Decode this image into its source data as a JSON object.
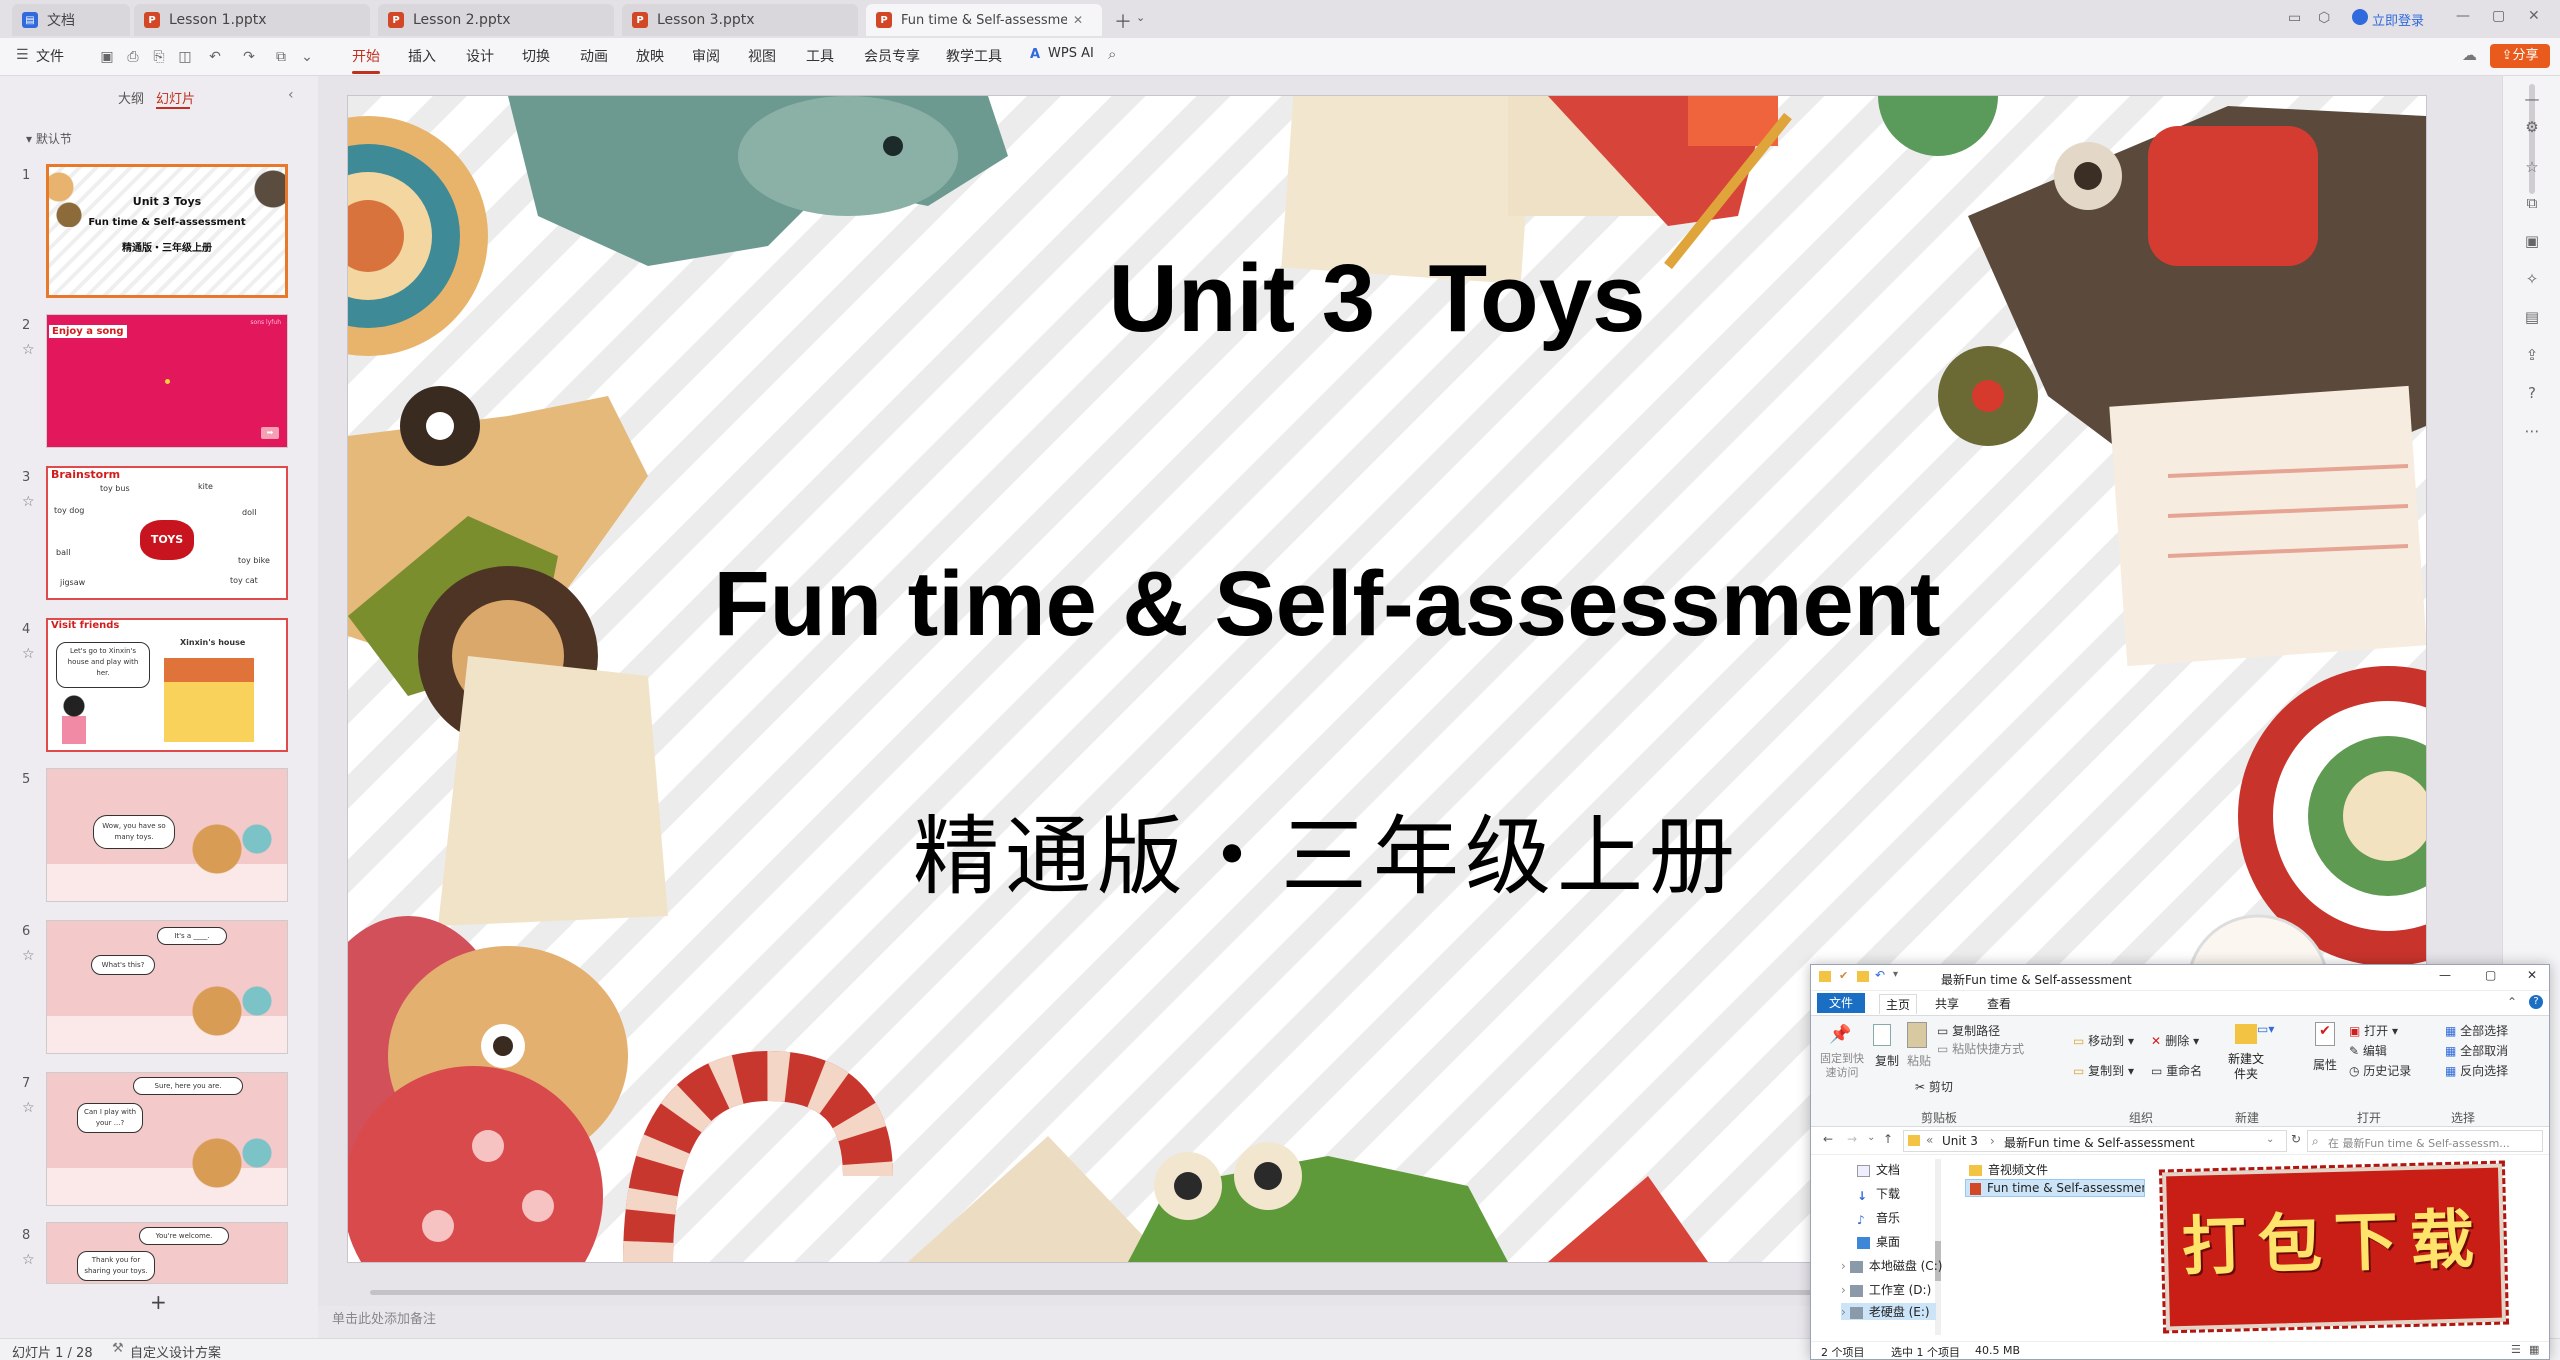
{
  "titlebar": {
    "tabs": [
      {
        "label": "文档",
        "color": "#2f6bdc"
      },
      {
        "label": "Lesson 1.pptx",
        "color": "#d24726"
      },
      {
        "label": "Lesson 2.pptx",
        "color": "#d24726"
      },
      {
        "label": "Lesson 3.pptx",
        "color": "#d24726"
      },
      {
        "label": "Fun time & Self-assessment",
        "color": "#d24726"
      }
    ],
    "login": "立即登录"
  },
  "ribbon": {
    "file": "文件",
    "tabs": [
      "开始",
      "插入",
      "设计",
      "切换",
      "动画",
      "放映",
      "审阅",
      "视图",
      "工具",
      "会员专享",
      "教学工具"
    ],
    "wps_ai": "WPS AI",
    "share": "分享"
  },
  "leftpane": {
    "view_outline": "大纲",
    "view_slides": "幻灯片",
    "section": "默认节",
    "slides": [
      {
        "num": "1",
        "title": "Unit 3  Toys",
        "sub1": "Fun time & Self-assessment",
        "sub2": "精通版・三年级上册"
      },
      {
        "num": "2",
        "title": "Enjoy a song",
        "corner": "sons lyfuh"
      },
      {
        "num": "3",
        "title": "Brainstorm",
        "words": [
          "toy bus",
          "kite",
          "toy dog",
          "doll",
          "ball",
          "toy bike",
          "jigsaw",
          "toy cat"
        ],
        "center": "TOYS"
      },
      {
        "num": "4",
        "title": "Visit friends",
        "bubble": "Let's go to Xinxin's house and play with her.",
        "house": "Xinxin's house"
      },
      {
        "num": "5",
        "bubble": "Wow, you have so many toys."
      },
      {
        "num": "6",
        "bubble1": "It's a ____.",
        "bubble2": "What's this?"
      },
      {
        "num": "7",
        "bubble1": "Sure, here you are.",
        "bubble2": "Can I play with your ...?"
      },
      {
        "num": "8",
        "bubble1": "You're welcome.",
        "bubble2": "Thank you for sharing your toys."
      }
    ],
    "add": "+"
  },
  "slide": {
    "title": "Unit 3  Toys",
    "subtitle": "Fun time & Self-assessment",
    "edition": "精通版・三年级上册"
  },
  "notes_placeholder": "单击此处添加备注",
  "statusbar": {
    "slide_counter": "幻灯片 1 / 28",
    "design": "自定义设计方案"
  },
  "explorer": {
    "title": "最新Fun time & Self-assessment",
    "ribbon_tabs": [
      "文件",
      "主页",
      "共享",
      "查看"
    ],
    "clipboard": {
      "pin": "固定到快速访问",
      "copy": "复制",
      "paste": "粘贴",
      "copy_path": "复制路径",
      "paste_shortcut": "粘贴快捷方式",
      "cut": "剪切",
      "group": "剪贴板"
    },
    "organize": {
      "move": "移动到",
      "copy_to": "复制到",
      "delete": "删除",
      "rename": "重命名",
      "group": "组织"
    },
    "new": {
      "folder": "新建文件夹",
      "group": "新建"
    },
    "open": {
      "properties": "属性",
      "open": "打开",
      "edit": "编辑",
      "history": "历史记录",
      "group": "打开"
    },
    "select": {
      "all": "全部选择",
      "none": "全部取消",
      "invert": "反向选择",
      "group": "选择"
    },
    "breadcrumb": [
      "Unit 3",
      "最新Fun time & Self-assessment"
    ],
    "search_placeholder": "在 最新Fun time & Self-assessm...",
    "nav": [
      "文档",
      "下载",
      "音乐",
      "桌面",
      "本地磁盘 (C:)",
      "工作室 (D:)",
      "老硬盘 (E:)"
    ],
    "files": [
      "音视频文件",
      "Fun time & Self-assessment.pptx"
    ],
    "status_items": "2 个项目",
    "status_selected": "选中 1 个项目",
    "status_size": "40.5 MB"
  },
  "stamp": {
    "text": "打包下载"
  }
}
